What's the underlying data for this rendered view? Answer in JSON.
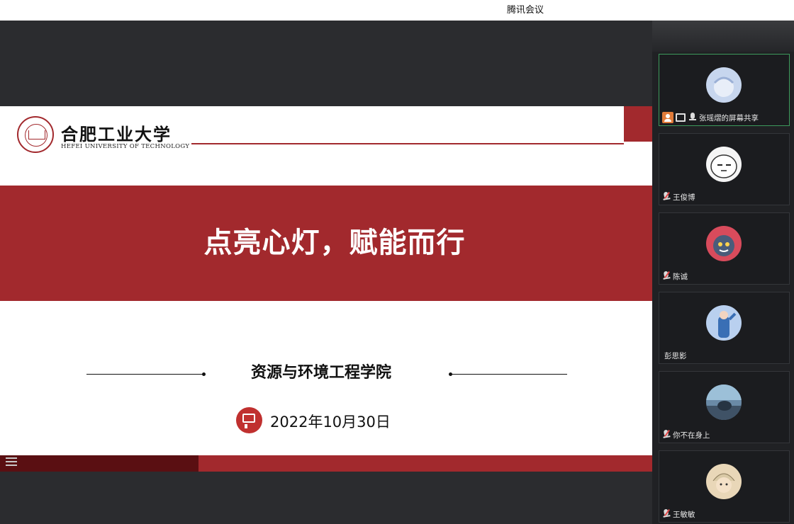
{
  "window": {
    "title": "腾讯会议"
  },
  "slide": {
    "logo_cn": "合肥工业大学",
    "logo_en": "HEFEI UNIVERSITY OF TECHNOLOGY",
    "headline": "点亮心灯，赋能而行",
    "college": "资源与环境工程学院",
    "date": "2022年10月30日"
  },
  "colors": {
    "brand_red": "#a2292d",
    "active_border": "#3d9a5c"
  },
  "participants": [
    {
      "name": "张瑶熠的屏幕共享",
      "sharing": true,
      "avatar_color": "#c7d6ee"
    },
    {
      "name": "王俊博",
      "sharing": false,
      "avatar_color": "#f5f5f5"
    },
    {
      "name": "陈诚",
      "sharing": false,
      "avatar_color": "#d84b5c"
    },
    {
      "name": "彭思影",
      "sharing": false,
      "avatar_color": "#b9d0ef"
    },
    {
      "name": "你不在身上",
      "sharing": false,
      "avatar_color": "#6a8aa6"
    },
    {
      "name": "王敏敏",
      "sharing": false,
      "avatar_color": "#e9d7b8"
    }
  ]
}
